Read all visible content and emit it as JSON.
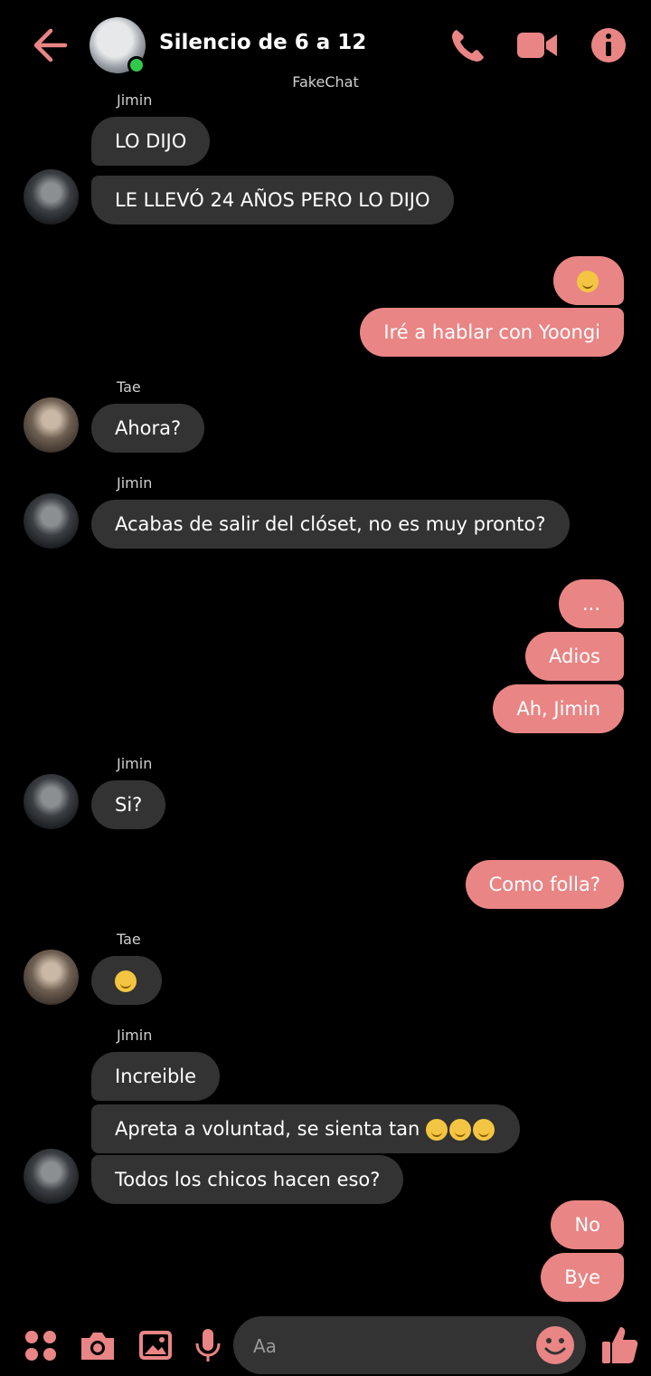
{
  "header": {
    "title": "Silencio de 6 a 12",
    "watermark": "FakeChat"
  },
  "messages": {
    "jimin_name_1": "Jimin",
    "m1": "LO DIJO",
    "m2": "LE LLEVÓ 24 AÑOS PERO LO DIJO",
    "m4": "Iré a hablar con Yoongi",
    "tae_name_1": "Tae",
    "m5": "Ahora?",
    "jimin_name_2": "Jimin",
    "m6": "Acabas de salir del clóset, no es muy pronto?",
    "m7": "...",
    "m8": "Adios",
    "m9": "Ah, Jimin",
    "jimin_name_3": "Jimin",
    "m10": "Si?",
    "m11": "Como folla?",
    "tae_name_2": "Tae",
    "jimin_name_4": "Jimin",
    "m13": "Increible",
    "m14": "Apreta a voluntad, se sienta tan",
    "m15": "Todos los chicos hacen eso?",
    "m16": "No",
    "m17": "Bye"
  },
  "composer": {
    "placeholder": "Aa"
  },
  "icons": [
    "back-arrow-icon",
    "phone-icon",
    "video-icon",
    "info-icon",
    "apps-icon",
    "camera-icon",
    "gallery-icon",
    "microphone-icon",
    "emoji-icon",
    "like-icon"
  ],
  "colors": {
    "accent": "#e98585",
    "incoming": "#333333",
    "online": "#31c94a"
  }
}
